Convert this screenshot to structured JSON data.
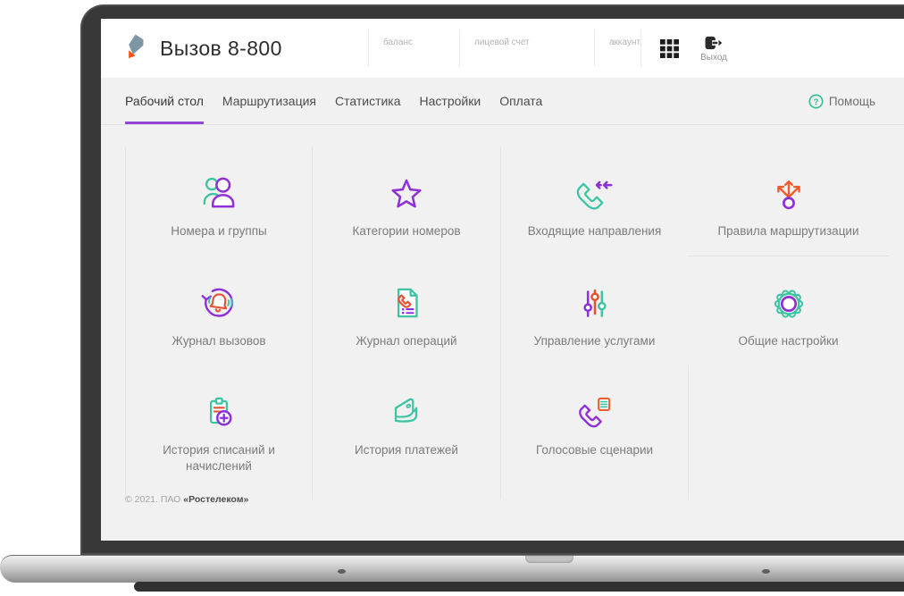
{
  "header": {
    "app_title": "Вызов 8-800",
    "logo": "rostelecom-logo",
    "fields": [
      {
        "label": "баланс"
      },
      {
        "label": "лицевой счет"
      },
      {
        "label": "аккаунт"
      }
    ],
    "apps_icon": "grid-apps-icon",
    "exit": {
      "label": "Выход",
      "icon": "logout-icon"
    }
  },
  "nav": {
    "tabs": [
      {
        "label": "Рабочий стол",
        "active": true
      },
      {
        "label": "Маршрутизация",
        "active": false
      },
      {
        "label": "Статистика",
        "active": false
      },
      {
        "label": "Настройки",
        "active": false
      },
      {
        "label": "Оплата",
        "active": false
      }
    ],
    "help": {
      "label": "Помощь",
      "icon": "help-icon"
    }
  },
  "tiles": [
    {
      "label": "Номера и группы",
      "icon": "users-icon",
      "divider_below": false
    },
    {
      "label": "Категории номеров",
      "icon": "star-icon",
      "divider_below": false
    },
    {
      "label": "Входящие направления",
      "icon": "incoming-call-icon",
      "divider_below": false
    },
    {
      "label": "Правила маршрутизации",
      "icon": "routing-arrows-icon",
      "divider_below": true
    },
    {
      "label": "Журнал вызовов",
      "icon": "call-log-icon",
      "divider_below": false
    },
    {
      "label": "Журнал операций",
      "icon": "operations-log-icon",
      "divider_below": false
    },
    {
      "label": "Управление услугами",
      "icon": "sliders-icon",
      "divider_below": false
    },
    {
      "label": "Общие настройки",
      "icon": "gear-icon",
      "divider_below": false
    },
    {
      "label": "История списаний и начислений",
      "icon": "clipboard-plus-icon",
      "divider_below": false
    },
    {
      "label": "История платежей",
      "icon": "wallet-icon",
      "divider_below": false
    },
    {
      "label": "Голосовые сценарии",
      "icon": "voice-script-icon",
      "divider_below": false
    }
  ],
  "footer": {
    "copyright_prefix": "© 2021. ПАО ",
    "company": "«Ростелеком»"
  },
  "colors": {
    "teal": "#3cc4a3",
    "purple": "#8e2fd8",
    "orange": "#ee5b2e",
    "red": "#e8502f",
    "tab_accent": "#9146d8",
    "help_green": "#2fbf8f",
    "brand_orange": "#ff4f12",
    "brand_slate": "#7e96a4"
  }
}
